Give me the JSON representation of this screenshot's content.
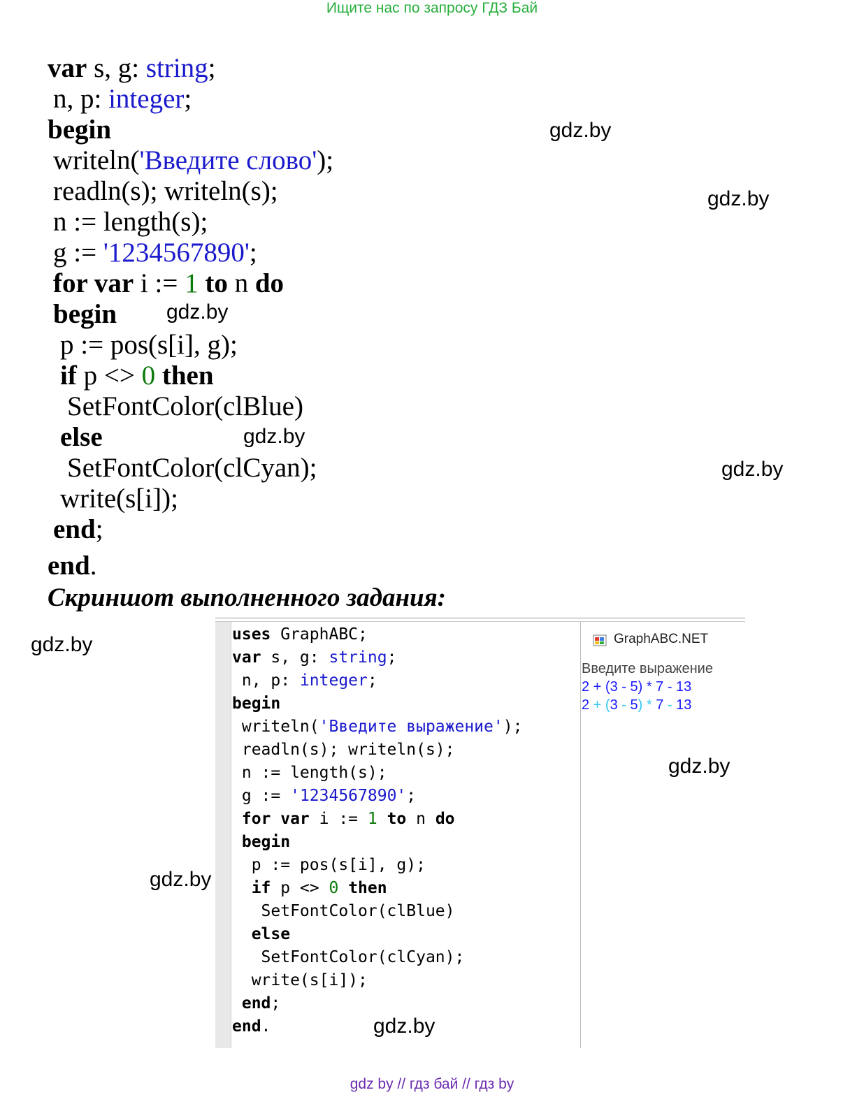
{
  "banner": "Ищите нас по запросу ГДЗ Бай",
  "watermark": "gdz.by",
  "code": {
    "l1": {
      "kw": "var",
      "a": " s, g: ",
      "ty": "string",
      "b": ";"
    },
    "l2": {
      "a": "n, p: ",
      "ty": "integer",
      "b": ";"
    },
    "l3": {
      "kw": "begin"
    },
    "l4": {
      "a": "writeln(",
      "st": "'Введите слово'",
      "b": ");"
    },
    "l5": {
      "a": "readln(s); writeln(s);"
    },
    "l6": {
      "a": "n := length(s);"
    },
    "l7": {
      "a": "g := ",
      "st": "'1234567890'",
      "b": ";"
    },
    "l8": {
      "kw1": "for var",
      "a": " i := ",
      "nu": "1",
      "kw2": " to",
      "b": " n ",
      "kw3": "do"
    },
    "l9": {
      "kw": "begin"
    },
    "l10": {
      "a": "p := pos(s[i], g);"
    },
    "l11": {
      "kw1": "if",
      "a": " p <> ",
      "nu": "0",
      "kw2": " then"
    },
    "l12": {
      "a": "SetFontColor(clBlue)"
    },
    "l13": {
      "kw": "else"
    },
    "l14": {
      "a": "SetFontColor(clCyan);"
    },
    "l15": {
      "a": "write(s[i]);"
    },
    "l16": {
      "kw": "end",
      "b": ";"
    },
    "l17": {
      "kw": "end",
      "b": "."
    }
  },
  "caption": "Скриншот выполненного задания:",
  "ide": {
    "m1": {
      "kw": "uses",
      "a": " GraphABC;"
    },
    "m2": {
      "kw": "var",
      "a": " s, g: ",
      "ty": "string",
      "b": ";"
    },
    "m3": {
      "a": " n, p: ",
      "ty": "integer",
      "b": ";"
    },
    "m4": {
      "kw": "begin"
    },
    "m5": {
      "a": " writeln(",
      "st": "'Введите выражение'",
      "b": ");"
    },
    "m6": {
      "a": " readln(s); writeln(s);"
    },
    "m7": {
      "a": " n := length(s);"
    },
    "m8": {
      "a": " g := ",
      "st": "'1234567890'",
      "b": ";"
    },
    "m9": {
      "kw1": " for var",
      "a": " i := ",
      "nu": "1",
      "kw2": " to",
      "b": " n ",
      "kw3": "do"
    },
    "m10": {
      "kw": " begin"
    },
    "m11": {
      "a": "  p := pos(s[i], g);"
    },
    "m12": {
      "kw1": "  if",
      "a": " p <> ",
      "nu": "0",
      "kw2": " then"
    },
    "m13": {
      "a": "   SetFontColor(clBlue)"
    },
    "m14": {
      "kw": "  else"
    },
    "m15": {
      "a": "   SetFontColor(clCyan);"
    },
    "m16": {
      "a": "  write(s[i]);"
    },
    "m17": {
      "kw": " end",
      "b": ";"
    },
    "m18": {
      "kw": "end",
      "b": "."
    }
  },
  "output_window": {
    "title": "GraphABC.NET",
    "prompt": "Введите выражение",
    "input_echo": "2 + (3 - 5) * 7 - 13",
    "colored_output": [
      {
        "t": "2",
        "c": "#1a1aff"
      },
      {
        "t": " + ",
        "c": "#33c6f0"
      },
      {
        "t": "(",
        "c": "#33c6f0"
      },
      {
        "t": "3",
        "c": "#1a1aff"
      },
      {
        "t": " - ",
        "c": "#33c6f0"
      },
      {
        "t": "5",
        "c": "#1a1aff"
      },
      {
        "t": ")",
        "c": "#33c6f0"
      },
      {
        "t": " * ",
        "c": "#33c6f0"
      },
      {
        "t": "7",
        "c": "#1a1aff"
      },
      {
        "t": " - ",
        "c": "#33c6f0"
      },
      {
        "t": "13",
        "c": "#1a1aff"
      }
    ]
  },
  "footer": "gdz by  //  гдз бай  //  гдз by",
  "colors": {
    "banner": "#27ae3c",
    "keyword_type": "#1a1acc",
    "number": "#0a7a0a",
    "footer": "#6a2bb0"
  }
}
